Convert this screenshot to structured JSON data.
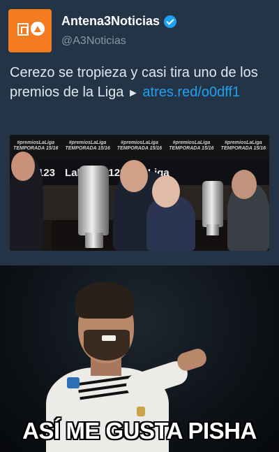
{
  "tweet": {
    "display_name": "Antena3Noticias",
    "verified": true,
    "handle": "@A3Noticias",
    "text": "Cerezo se tropieza y casi tira uno de los premios de la Liga",
    "arrow": "►",
    "link": "atres.red/o0dff1",
    "colors": {
      "background": "#243447",
      "link": "#1da1f2",
      "avatar": "#f47c20"
    },
    "photo": {
      "backdrop_labels": [
        "#premiosLaLiga TEMPORADA 15/16",
        "#premiosLaLiga TEMPORADA 15/16",
        "#premiosLaLiga TEMPORADA 15/16",
        "#premiosLaLiga TEMPORADA 15/16",
        "#premiosLaLiga TEMPORADA 15/16"
      ],
      "sponsor_text": [
        "123",
        "LaLiga",
        "123",
        "LaLiga"
      ]
    }
  },
  "meme": {
    "caption": "ASÍ ME GUSTA PISHA"
  }
}
